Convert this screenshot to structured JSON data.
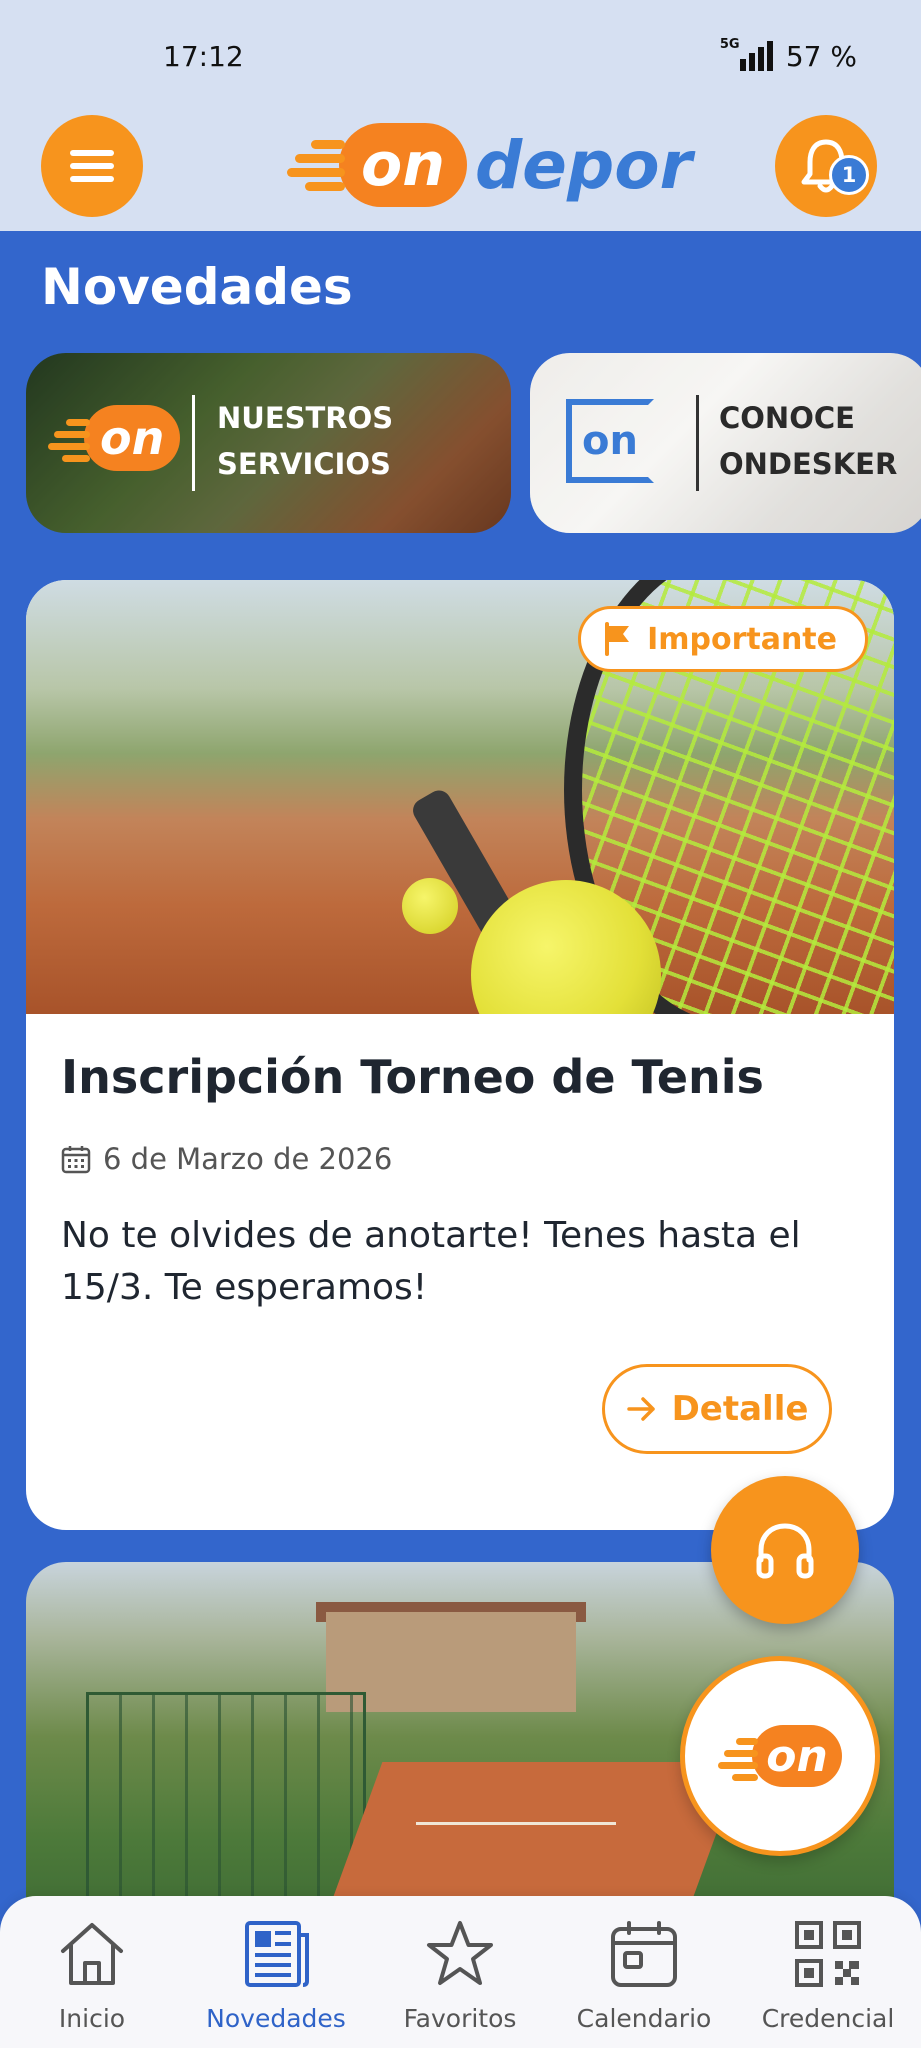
{
  "status_bar": {
    "time": "17:12",
    "network": "5G",
    "battery": "57 %"
  },
  "header": {
    "brand_on": "on",
    "brand_word": "depor",
    "notification_count": "1"
  },
  "page": {
    "title": "Novedades"
  },
  "banners": [
    {
      "logo": "on",
      "line1": "NUESTROS",
      "line2": "SERVICIOS"
    },
    {
      "logo": "on",
      "line1": "CONOCE",
      "line2": "ONDESKER"
    }
  ],
  "news": [
    {
      "tag": "Importante",
      "title": "Inscripción Torneo de Tenis",
      "date": "6 de Marzo de 2026",
      "body": "No te olvides de anotarte! Tenes hasta el 15/3. Te esperamos!",
      "action": "Detalle"
    }
  ],
  "fab": {
    "support_icon": "headphones-icon",
    "brand": "on"
  },
  "bottom_nav": [
    {
      "label": "Inicio",
      "icon": "home-icon",
      "active": false
    },
    {
      "label": "Novedades",
      "icon": "newspaper-icon",
      "active": true
    },
    {
      "label": "Favoritos",
      "icon": "star-icon",
      "active": false
    },
    {
      "label": "Calendario",
      "icon": "calendar-icon",
      "active": false
    },
    {
      "label": "Credencial",
      "icon": "qr-code-icon",
      "active": false
    }
  ],
  "colors": {
    "primary_blue": "#3366cc",
    "accent_orange": "#f7941d",
    "header_bg": "#d6e0f2"
  }
}
